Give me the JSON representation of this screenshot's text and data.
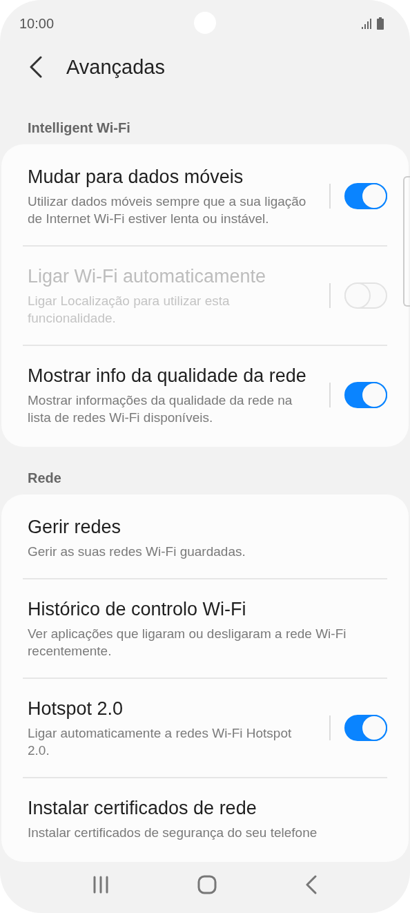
{
  "status_bar": {
    "time": "10:00"
  },
  "header": {
    "title": "Avançadas"
  },
  "sections": [
    {
      "label": "Intelligent Wi-Fi",
      "items": [
        {
          "kind": "toggle",
          "title": "Mudar para dados móveis",
          "subtitle": "Utilizar dados móveis sempre que a sua ligação de Internet Wi-Fi estiver lenta ou instável.",
          "on": true,
          "disabled": false
        },
        {
          "kind": "toggle",
          "title": "Ligar Wi-Fi automaticamente",
          "subtitle": "Ligar Localização para utilizar esta funcionalidade.",
          "on": false,
          "disabled": true
        },
        {
          "kind": "toggle",
          "title": "Mostrar info da qualidade da rede",
          "subtitle": "Mostrar informações da qualidade da rede na lista de redes Wi-Fi disponíveis.",
          "on": true,
          "disabled": false
        }
      ]
    },
    {
      "label": "Rede",
      "items": [
        {
          "kind": "link",
          "title": "Gerir redes",
          "subtitle": "Gerir as suas redes Wi-Fi guardadas."
        },
        {
          "kind": "link",
          "title": "Histórico de controlo Wi-Fi",
          "subtitle": "Ver aplicações que ligaram ou desligaram a rede Wi-Fi recentemente."
        },
        {
          "kind": "toggle",
          "title": "Hotspot 2.0",
          "subtitle": "Ligar automaticamente a redes Wi-Fi Hotspot 2.0.",
          "on": true,
          "disabled": false
        },
        {
          "kind": "link",
          "title": "Instalar certificados de rede",
          "subtitle": "Instalar certificados de segurança do seu telefone"
        }
      ]
    }
  ]
}
